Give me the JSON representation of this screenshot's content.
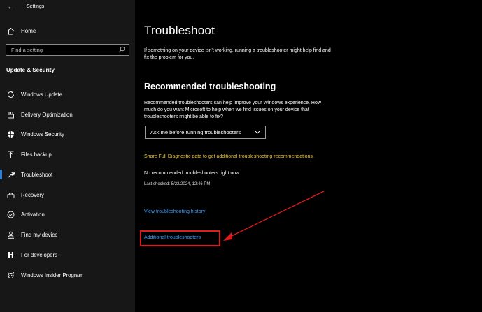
{
  "window": {
    "app_title": "Settings"
  },
  "sidebar": {
    "home_label": "Home",
    "search_placeholder": "Find a setting",
    "section_title": "Update & Security",
    "items": [
      {
        "label": "Windows Update",
        "icon": "refresh-icon"
      },
      {
        "label": "Delivery Optimization",
        "icon": "delivery-icon"
      },
      {
        "label": "Windows Security",
        "icon": "shield-icon"
      },
      {
        "label": "Files backup",
        "icon": "upload-icon"
      },
      {
        "label": "Troubleshoot",
        "icon": "wrench-icon",
        "active": true
      },
      {
        "label": "Recovery",
        "icon": "recovery-icon"
      },
      {
        "label": "Activation",
        "icon": "check-circle-icon"
      },
      {
        "label": "Find my device",
        "icon": "person-pin-icon"
      },
      {
        "label": "For developers",
        "icon": "developer-icon"
      },
      {
        "label": "Windows Insider Program",
        "icon": "insider-icon"
      }
    ]
  },
  "main": {
    "title": "Troubleshoot",
    "intro": "If something on your device isn't working, running a troubleshooter might help find and fix the problem for you.",
    "recommended_heading": "Recommended troubleshooting",
    "recommended_desc": "Recommended troubleshooters can help improve your Windows experience. How much do you want Microsoft to help when we find issues on your device that troubleshooters might be able to fix?",
    "dropdown_value": "Ask me before running troubleshooters",
    "diagnostic_link": "Share Full Diagnostic data to get additional troubleshooting recommendations.",
    "no_recommended": "No recommended troubleshooters right now",
    "last_checked": "Last checked: 5/22/2024, 12:46 PM",
    "history_link": "View troubleshooting history",
    "additional_link": "Additional troubleshooters"
  },
  "colors": {
    "accent": "#2b7fd6",
    "link": "#3b9dff",
    "warning_link": "#e7c43a",
    "annotation": "#e01b1b"
  }
}
